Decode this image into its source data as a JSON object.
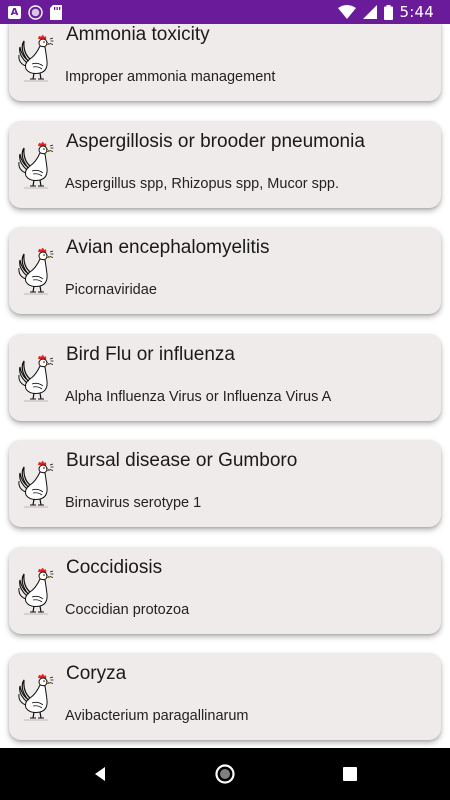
{
  "status_bar": {
    "time": "5:44",
    "left_icons": [
      "a-notification-icon",
      "circle-notification-icon",
      "sd-card-icon"
    ],
    "right_icons": [
      "wifi-icon",
      "signal-icon",
      "battery-icon"
    ],
    "bg_color": "#6a1b9a"
  },
  "diseases": [
    {
      "title": "Ammonia toxicity",
      "subtitle": "Improper ammonia management"
    },
    {
      "title": "Aspergillosis or brooder pneumonia",
      "subtitle": "Aspergillus spp, Rhizopus spp, Mucor spp."
    },
    {
      "title": "Avian encephalomyelitis",
      "subtitle": "Picornaviridae"
    },
    {
      "title": "Bird Flu or influenza",
      "subtitle": "Alpha Influenza Virus or Influenza Virus A"
    },
    {
      "title": "Bursal disease or Gumboro",
      "subtitle": "Birnavirus serotype 1"
    },
    {
      "title": "Coccidiosis",
      "subtitle": "Coccidian protozoa"
    },
    {
      "title": "Coryza",
      "subtitle": "Avibacterium paragallinarum"
    }
  ],
  "card_icon": "rooster-icon",
  "nav_bar": {
    "icons": [
      "back-icon",
      "home-icon",
      "recents-icon"
    ]
  }
}
